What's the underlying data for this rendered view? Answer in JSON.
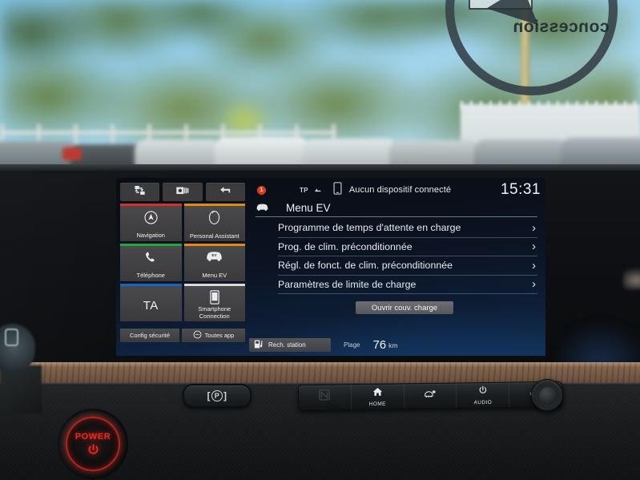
{
  "scene": {
    "windshield_sticker_text": "concession"
  },
  "screen": {
    "quick_bar": [
      {
        "name": "split-screen-icon",
        "label": "Split screen"
      },
      {
        "name": "camera-icon",
        "label": "Camera"
      },
      {
        "name": "back-arrow-icon",
        "label": "Back"
      }
    ],
    "tiles": [
      {
        "label": "Navigation",
        "icon": "compass-icon",
        "accent": "#d32f2f"
      },
      {
        "label": "Personal Assistant",
        "icon": "assistant-icon",
        "accent": "#e08a10"
      },
      {
        "label": "Téléphone",
        "icon": "phone-icon",
        "accent": "#25a63b"
      },
      {
        "label": "Menu EV",
        "icon": "ev-car-icon",
        "accent": "#e08a10"
      },
      {
        "label": "TA",
        "icon": "ta-text",
        "accent": "#1565c0"
      },
      {
        "label": "Smartphone Connection",
        "icon": "smartphone-icon",
        "accent": "#d8d8d8"
      }
    ],
    "bottom_buttons": [
      {
        "label": "Config sécurité",
        "icon": ""
      },
      {
        "label": "Toutes app",
        "icon": "all-apps-icon"
      }
    ],
    "status_bar": {
      "notification_count": "1",
      "tp_label": "TP",
      "device_text": "Aucun dispositif connecté",
      "clock": "15:31"
    },
    "page": {
      "icon": "ev-car-icon",
      "title": "Menu EV",
      "menu_items": [
        {
          "label": "Programme de temps d'attente en charge",
          "chevron": "›"
        },
        {
          "label": "Prog. de clim. préconditionnée",
          "chevron": "›"
        },
        {
          "label": "Régl. de fonct. de clim. préconditionnée",
          "chevron": "›"
        },
        {
          "label": "Paramètres de limite de charge",
          "chevron": "›"
        }
      ],
      "action_button": "Ouvrir couv. charge"
    },
    "ev_bar": {
      "station_label": "Rech. station",
      "range_label": "Plage",
      "range_value": "76",
      "range_unit": "km"
    }
  },
  "console": {
    "park_button": {
      "left_bracket": "[",
      "letter": "P",
      "right_bracket": "]"
    },
    "keys": [
      {
        "name": "nfc-icon",
        "label": ""
      },
      {
        "name": "home-icon",
        "label": "HOME"
      },
      {
        "name": "defrost-icon",
        "label": ""
      },
      {
        "name": "audio-power-icon",
        "label": "AUDIO"
      },
      {
        "name": "volume-icon",
        "label": "VOL"
      }
    ],
    "power_button": {
      "label": "POWER"
    }
  },
  "colors": {
    "accent_blue": "#1565c0",
    "alert_red": "#e03a1c",
    "power_red": "#e8291d",
    "screen_bg": "#0b1220"
  }
}
